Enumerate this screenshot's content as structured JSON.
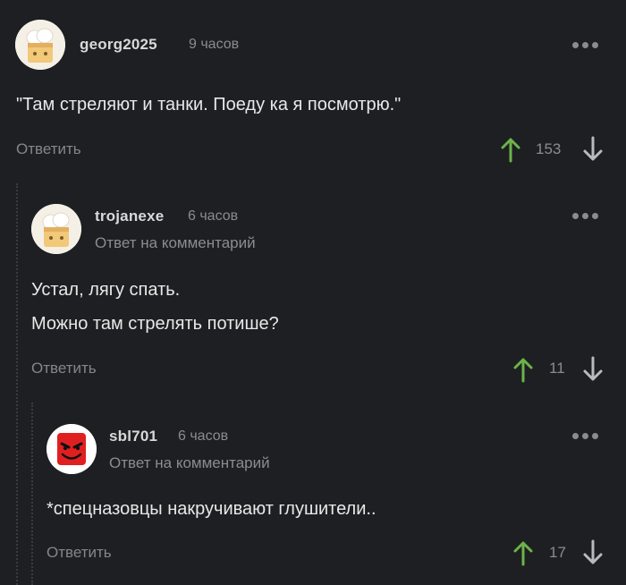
{
  "comments": [
    {
      "username": "georg2025",
      "time": "9 часов",
      "lines": [
        "\"Там стреляют и танки. Поеду ка я посмотрю.\""
      ],
      "reply_label": "Ответить",
      "score": "153",
      "avatar_icon": "chef-avatar-icon"
    },
    {
      "username": "trojanexe",
      "time": "6 часов",
      "reply_to": "Ответ на комментарий",
      "lines": [
        "Устал, лягу спать.",
        "Можно там стрелять потише?"
      ],
      "reply_label": "Ответить",
      "score": "11",
      "avatar_icon": "chef-avatar-icon"
    },
    {
      "username": "sbl701",
      "time": "6 часов",
      "reply_to": "Ответ на комментарий",
      "lines": [
        "*спецназовцы накручивают глушители.."
      ],
      "reply_label": "Ответить",
      "score": "17",
      "avatar_icon": "devil-smiley-avatar-icon"
    }
  ],
  "colors": {
    "upvote": "#6cb34a",
    "downvote": "#b8babd",
    "background": "#1e1f22"
  }
}
